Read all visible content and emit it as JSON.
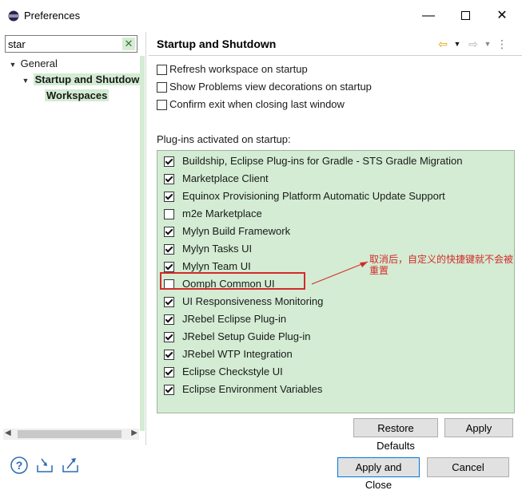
{
  "window": {
    "title": "Preferences",
    "minimize_glyph": "—",
    "close_glyph": "✕"
  },
  "filter": {
    "value": "star",
    "clear_glyph": "✕"
  },
  "tree": {
    "items": [
      {
        "label": "General",
        "expanded": true
      },
      {
        "label": "Startup and Shutdow",
        "expanded": true,
        "selected": true
      },
      {
        "label": "Workspaces",
        "selected": true
      }
    ]
  },
  "page": {
    "title": "Startup and Shutdown"
  },
  "options": [
    {
      "label": "Refresh workspace on startup",
      "checked": false
    },
    {
      "label": "Show Problems view decorations on startup",
      "checked": false
    },
    {
      "label": "Confirm exit when closing last window",
      "checked": false
    }
  ],
  "plugins": {
    "label": "Plug-ins activated on startup:",
    "items": [
      {
        "label": "Buildship, Eclipse Plug-ins for Gradle - STS Gradle Migration",
        "checked": true
      },
      {
        "label": "Marketplace Client",
        "checked": true
      },
      {
        "label": "Equinox Provisioning Platform Automatic Update Support",
        "checked": true
      },
      {
        "label": "m2e Marketplace",
        "checked": false
      },
      {
        "label": "Mylyn Build Framework",
        "checked": true
      },
      {
        "label": "Mylyn Tasks UI",
        "checked": true
      },
      {
        "label": "Mylyn Team UI",
        "checked": true
      },
      {
        "label": "Oomph Common UI",
        "checked": false
      },
      {
        "label": "UI Responsiveness Monitoring",
        "checked": true
      },
      {
        "label": "JRebel Eclipse Plug-in",
        "checked": true
      },
      {
        "label": "JRebel Setup Guide Plug-in",
        "checked": true
      },
      {
        "label": "JRebel WTP Integration",
        "checked": true
      },
      {
        "label": "Eclipse Checkstyle UI",
        "checked": true
      },
      {
        "label": "Eclipse Environment Variables",
        "checked": true
      }
    ]
  },
  "annotation": {
    "text": "取消后，自定义的快捷键就不会被重置"
  },
  "buttons": {
    "restore_defaults": "Restore Defaults",
    "apply": "Apply",
    "apply_and_close": "Apply and Close",
    "cancel": "Cancel"
  },
  "icons": {
    "app": "eclipse-icon",
    "help": "help-icon",
    "import": "import-icon",
    "export": "export-icon",
    "back": "back-arrow-icon",
    "forward": "forward-arrow-icon",
    "menu": "view-menu-icon"
  },
  "colors": {
    "selection": "#d3ecd3",
    "annotation": "#d42a2a",
    "nav_arrow": "#e8a000"
  }
}
